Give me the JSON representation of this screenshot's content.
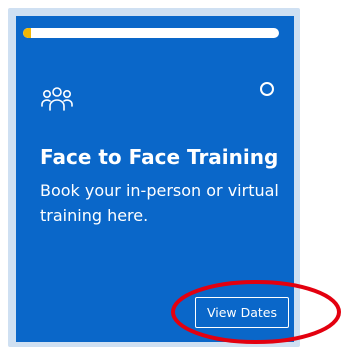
{
  "card": {
    "title": "Face to Face Training",
    "description": "Book your in-person or virtual training here.",
    "button_label": "View Dates",
    "progress_fraction": 0.03,
    "icon": "people-group-icon",
    "status_icon": "status-circle-icon"
  },
  "colors": {
    "card_background": "#0a67c9",
    "frame_background": "#cfe0f2",
    "progress_accent": "#f2b705",
    "annotation": "#e3000f"
  }
}
